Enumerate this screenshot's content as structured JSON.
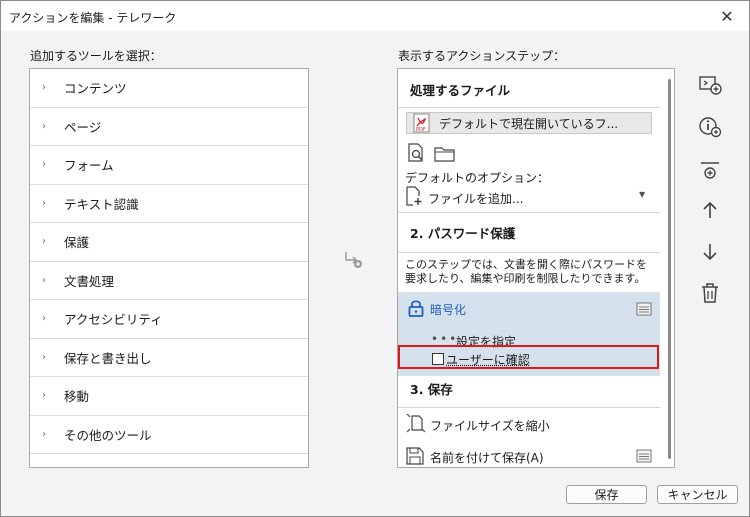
{
  "window": {
    "title": "アクションを編集 - テレワーク",
    "close_glyph": "✕"
  },
  "left": {
    "heading": "追加するツールを選択：",
    "tools": [
      "コンテンツ",
      "ページ",
      "フォーム",
      "テキスト認識",
      "保護",
      "文書処理",
      "アクセシビリティ",
      "保存と書き出し",
      "移動",
      "その他のツール"
    ]
  },
  "right": {
    "heading": "表示するアクションステップ：",
    "section1": {
      "title": "処理するファイル",
      "file_label": "デフォルトで現在開いているフ...",
      "pdf_tag": "PDF",
      "options_label": "デフォルトのオプション：",
      "add_files": "ファイルを追加..."
    },
    "section2": {
      "title": "2. パスワード保護",
      "description": "このステップでは、文書を開く際にパスワードを要求したり、編集や印刷を制限したりできます。",
      "encrypt_label": "暗号化",
      "settings_label": "設定を指定",
      "confirm_label": "ユーザーに確認"
    },
    "section3": {
      "title": "3. 保存",
      "reduce_size": "ファイルサイズを縮小",
      "save_as": "名前を付けて保存(A)"
    }
  },
  "footer": {
    "save": "保存",
    "cancel": "キャンセル"
  },
  "colors": {
    "accent_blue": "#1f5fbf",
    "highlight_red": "#e01818",
    "selected_bg": "#d5e2ee"
  }
}
